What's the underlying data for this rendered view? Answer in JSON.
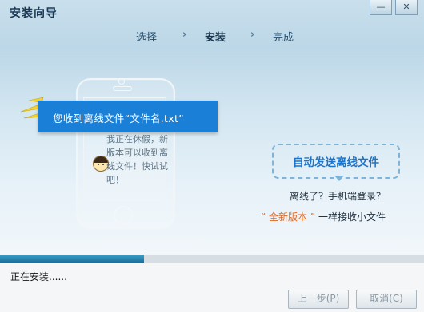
{
  "window": {
    "title": "安装向导",
    "controls": {
      "minimize": "—",
      "close": "✕"
    }
  },
  "steps": {
    "items": [
      "选择",
      "安装",
      "完成"
    ],
    "active": "安装",
    "separator": "›"
  },
  "illustration": {
    "notification": "您收到离线文件“文件名.txt”",
    "chat_message": "我正在休假，新版本可以收到离线文件！快试试吧！"
  },
  "promo": {
    "badge": "自动发送离线文件",
    "line1": "离线了？手机端登录？",
    "line2_quote_open": "“",
    "line2_highlight": "全新版本",
    "line2_quote_close": "”",
    "line2_rest": "一样接收小文件"
  },
  "progress": {
    "fraction": 0.34,
    "status": "正在安装......"
  },
  "buttons": {
    "back": "上一步(P)",
    "cancel": "取消(C)"
  },
  "colors": {
    "accent": "#1a7fd6",
    "progress": "#2b8cb8",
    "highlight": "#e0661f"
  }
}
